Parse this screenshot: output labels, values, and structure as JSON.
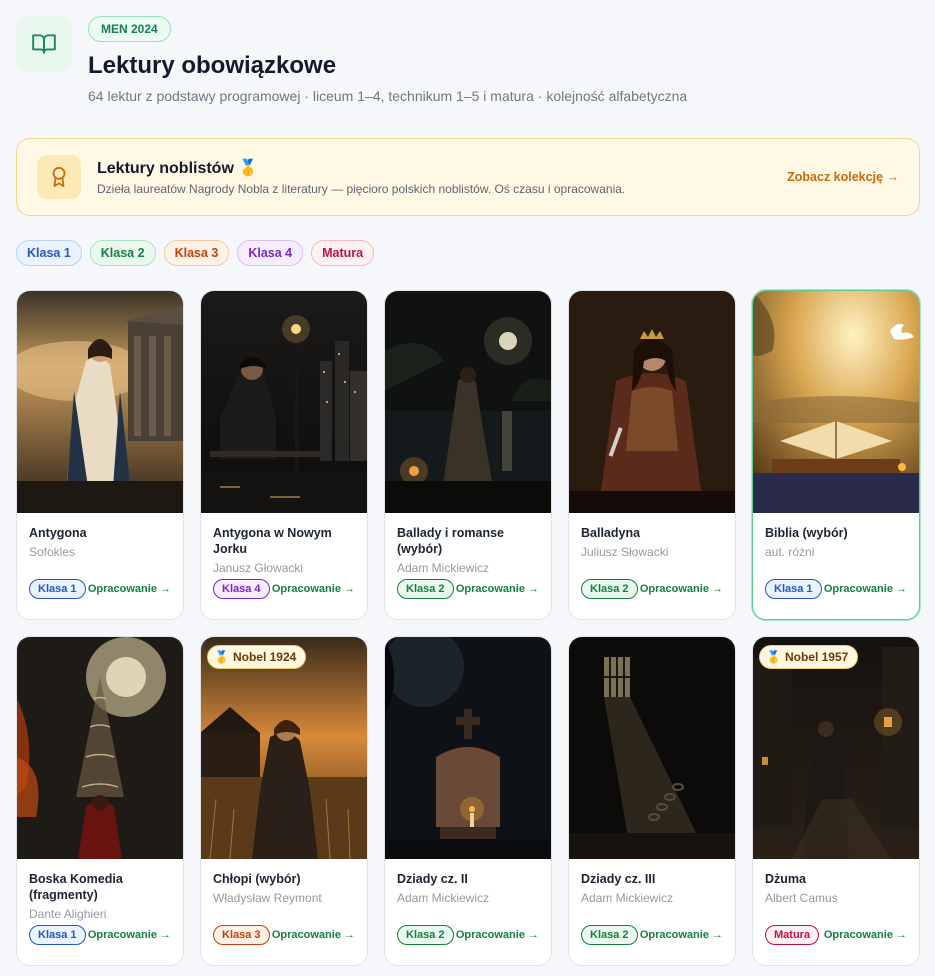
{
  "header": {
    "badge": "MEN 2024",
    "title": "Lektury obowiązkowe",
    "subtitle": "64 lektur z podstawy programowej · liceum 1–4, technikum 1–5 i matura · kolejność alfabetyczna"
  },
  "nobel_banner": {
    "title": "Lektury noblistów 🥇",
    "description": "Dzieła laureatów Nagrody Nobla z literatury — pięcioro polskich noblistów. Oś czasu i opracowania.",
    "link": "Zobacz kolekcję →"
  },
  "filters": [
    "Klasa 1",
    "Klasa 2",
    "Klasa 3",
    "Klasa 4",
    "Matura"
  ],
  "colors": {
    "accent_green": "#15803d",
    "nobel_gold": "#c76a09",
    "klasa1": "#2457c5",
    "klasa2": "#15803d",
    "klasa3": "#c2410c",
    "klasa4": "#7e22ce",
    "matura": "#be123c"
  },
  "cards": [
    {
      "title": "Antygona",
      "author": "Sofokles",
      "level": "Klasa 1",
      "level_key": "c1",
      "link": "Opracowanie →",
      "nobel": "",
      "cover": "greek-woman-temple"
    },
    {
      "title": "Antygona w Nowym Jorku",
      "author": "Janusz Głowacki",
      "level": "Klasa 4",
      "level_key": "c4",
      "link": "Opracowanie →",
      "nobel": "",
      "cover": "man-on-bench-city-night"
    },
    {
      "title": "Ballady i romanse (wybór)",
      "author": "Adam Mickiewicz",
      "level": "Klasa 2",
      "level_key": "c2",
      "link": "Opracowanie →",
      "nobel": "",
      "cover": "woman-by-lake-moon"
    },
    {
      "title": "Balladyna",
      "author": "Juliusz Słowacki",
      "level": "Klasa 2",
      "level_key": "c2",
      "link": "Opracowanie →",
      "nobel": "",
      "cover": "queen-with-knife"
    },
    {
      "title": "Biblia (wybór)",
      "author": "aut. różni",
      "level": "Klasa 1",
      "level_key": "c1",
      "link": "Opracowanie →",
      "nobel": "",
      "cover": "open-bible-dove",
      "selected": true
    },
    {
      "title": "Boska Komedia (fragmenty)",
      "author": "Dante Alighieri",
      "level": "Klasa 1",
      "level_key": "c1",
      "link": "Opracowanie →",
      "nobel": "",
      "cover": "spiral-to-heaven"
    },
    {
      "title": "Chłopi (wybór)",
      "author": "Władysław Reymont",
      "level": "Klasa 3",
      "level_key": "c3",
      "link": "Opracowanie →",
      "nobel": "Nobel 1924",
      "cover": "peasant-woman-field"
    },
    {
      "title": "Dziady cz. II",
      "author": "Adam Mickiewicz",
      "level": "Klasa 2",
      "level_key": "c2",
      "link": "Opracowanie →",
      "nobel": "",
      "cover": "grave-candle"
    },
    {
      "title": "Dziady cz. III",
      "author": "Adam Mickiewicz",
      "level": "Klasa 2",
      "level_key": "c2",
      "link": "Opracowanie →",
      "nobel": "",
      "cover": "prison-cell-chains"
    },
    {
      "title": "Dżuma",
      "author": "Albert Camus",
      "level": "Matura",
      "level_key": "cm",
      "link": "Opracowanie →",
      "nobel": "Nobel 1957",
      "cover": "man-in-dark-street"
    }
  ]
}
